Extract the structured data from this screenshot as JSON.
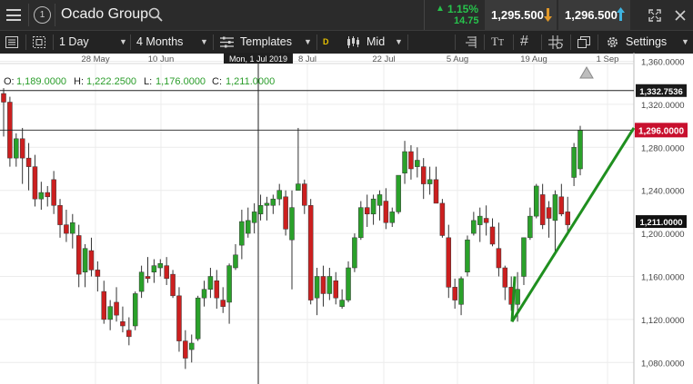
{
  "header": {
    "menu_icon": "hamburger-icon",
    "info_icon": "info-circle-icon",
    "instrument": "Ocado Group",
    "search_icon": "search-icon",
    "change_pct": "1.15%",
    "change_abs": "14.75",
    "sell_price": "1,295.500",
    "buy_price": "1,296.500",
    "sell_icon": "arrow-down-icon",
    "buy_icon": "arrow-up-icon",
    "fullscreen_icon": "fullscreen-icon",
    "close_icon": "close-icon",
    "colors": {
      "up": "#27c24c",
      "sell_arrow": "#e0982a",
      "buy_arrow": "#3fb3e0"
    }
  },
  "toolbar": {
    "interval": "1 Day",
    "range": "4 Months",
    "templates": "Templates",
    "d_badge": "D",
    "price_type": "Mid",
    "settings": "Settings",
    "icons": [
      "list-icon",
      "layout-icon",
      "templates-icon",
      "text-icon",
      "grid-icon",
      "crosshair-settings-icon",
      "window-icon",
      "gear-icon"
    ]
  },
  "crosshair_date": "Mon, 1 Jul 2019",
  "ohlc": {
    "o_label": "O:",
    "o": "1,189.0000",
    "h_label": "H:",
    "h": "1,222.2500",
    "l_label": "L:",
    "l": "1,176.0000",
    "c_label": "C:",
    "c": "1,211.0000"
  },
  "price_labels": {
    "crosshair": "1,332.7536",
    "current": "1,296.0000",
    "close": "1,211.0000"
  },
  "chart_data": {
    "type": "candlestick",
    "x_ticks": [
      "28 May",
      "10 Jun",
      "Mon, 1 Jul 2019",
      "8 Jul",
      "22 Jul",
      "5 Aug",
      "19 Aug",
      "1 Sep"
    ],
    "y_ticks": [
      "1,080.0000",
      "1,120.0000",
      "1,160.0000",
      "1,200.0000",
      "1,240.0000",
      "1,280.0000",
      "1,320.0000",
      "1,360.0000"
    ],
    "ylim": [
      1060,
      1368
    ],
    "grid": true,
    "crosshair_price": 1332.7536,
    "current_price": 1296,
    "trendline": [
      [
        1118,
        1298
      ],
      [
        1118,
        1118
      ]
    ],
    "candles": [
      [
        1330,
        1335,
        1290,
        1322
      ],
      [
        1322,
        1327,
        1262,
        1270
      ],
      [
        1270,
        1293,
        1262,
        1288
      ],
      [
        1288,
        1298,
        1246,
        1270
      ],
      [
        1270,
        1284,
        1240,
        1262
      ],
      [
        1262,
        1273,
        1225,
        1232
      ],
      [
        1232,
        1248,
        1222,
        1238
      ],
      [
        1238,
        1244,
        1225,
        1234
      ],
      [
        1250,
        1258,
        1218,
        1226
      ],
      [
        1226,
        1232,
        1196,
        1208
      ],
      [
        1208,
        1222,
        1192,
        1200
      ],
      [
        1200,
        1218,
        1186,
        1210
      ],
      [
        1198,
        1208,
        1150,
        1162
      ],
      [
        1164,
        1190,
        1150,
        1186
      ],
      [
        1184,
        1196,
        1160,
        1166
      ],
      [
        1166,
        1174,
        1146,
        1160
      ],
      [
        1146,
        1156,
        1116,
        1120
      ],
      [
        1120,
        1138,
        1110,
        1132
      ],
      [
        1136,
        1150,
        1118,
        1124
      ],
      [
        1118,
        1132,
        1108,
        1114
      ],
      [
        1110,
        1122,
        1096,
        1104
      ],
      [
        1114,
        1146,
        1110,
        1144
      ],
      [
        1146,
        1170,
        1140,
        1164
      ],
      [
        1160,
        1178,
        1154,
        1158
      ],
      [
        1164,
        1176,
        1154,
        1170
      ],
      [
        1168,
        1176,
        1160,
        1172
      ],
      [
        1170,
        1178,
        1152,
        1158
      ],
      [
        1162,
        1166,
        1140,
        1142
      ],
      [
        1142,
        1150,
        1090,
        1100
      ],
      [
        1100,
        1110,
        1074,
        1084
      ],
      [
        1092,
        1106,
        1080,
        1098
      ],
      [
        1102,
        1142,
        1100,
        1140
      ],
      [
        1140,
        1156,
        1132,
        1148
      ],
      [
        1148,
        1168,
        1140,
        1160
      ],
      [
        1156,
        1166,
        1130,
        1140
      ],
      [
        1138,
        1150,
        1126,
        1132
      ],
      [
        1136,
        1172,
        1116,
        1170
      ],
      [
        1168,
        1190,
        1166,
        1180
      ],
      [
        1189,
        1222,
        1176,
        1211
      ],
      [
        1200,
        1224,
        1196,
        1212
      ],
      [
        1210,
        1228,
        1200,
        1220
      ],
      [
        1218,
        1236,
        1212,
        1226
      ],
      [
        1226,
        1234,
        1212,
        1228
      ],
      [
        1226,
        1236,
        1218,
        1232
      ],
      [
        1232,
        1246,
        1226,
        1240
      ],
      [
        1234,
        1240,
        1198,
        1204
      ],
      [
        1194,
        1240,
        1148,
        1224
      ],
      [
        1240,
        1298,
        1240,
        1246
      ],
      [
        1246,
        1250,
        1218,
        1226
      ],
      [
        1226,
        1232,
        1134,
        1138
      ],
      [
        1140,
        1168,
        1124,
        1160
      ],
      [
        1160,
        1170,
        1132,
        1144
      ],
      [
        1144,
        1168,
        1138,
        1160
      ],
      [
        1156,
        1164,
        1134,
        1140
      ],
      [
        1132,
        1148,
        1130,
        1138
      ],
      [
        1138,
        1174,
        1136,
        1168
      ],
      [
        1168,
        1200,
        1164,
        1196
      ],
      [
        1196,
        1230,
        1194,
        1224
      ],
      [
        1224,
        1236,
        1206,
        1218
      ],
      [
        1218,
        1236,
        1208,
        1232
      ],
      [
        1226,
        1240,
        1212,
        1236
      ],
      [
        1230,
        1242,
        1204,
        1210
      ],
      [
        1210,
        1224,
        1206,
        1220
      ],
      [
        1220,
        1244,
        1218,
        1254
      ],
      [
        1256,
        1286,
        1246,
        1276
      ],
      [
        1276,
        1282,
        1250,
        1260
      ],
      [
        1262,
        1280,
        1252,
        1268
      ],
      [
        1262,
        1270,
        1232,
        1246
      ],
      [
        1246,
        1262,
        1236,
        1250
      ],
      [
        1250,
        1262,
        1228,
        1228
      ],
      [
        1228,
        1232,
        1196,
        1198
      ],
      [
        1196,
        1208,
        1140,
        1150
      ],
      [
        1150,
        1158,
        1130,
        1138
      ],
      [
        1134,
        1160,
        1124,
        1158
      ],
      [
        1164,
        1198,
        1160,
        1194
      ],
      [
        1200,
        1220,
        1198,
        1212
      ],
      [
        1208,
        1224,
        1192,
        1216
      ],
      [
        1214,
        1226,
        1198,
        1210
      ],
      [
        1206,
        1214,
        1188,
        1190
      ],
      [
        1186,
        1210,
        1160,
        1168
      ],
      [
        1168,
        1170,
        1138,
        1150
      ],
      [
        1150,
        1160,
        1128,
        1134
      ],
      [
        1134,
        1164,
        1118,
        1148
      ],
      [
        1160,
        1196,
        1152,
        1196
      ],
      [
        1196,
        1224,
        1194,
        1216
      ],
      [
        1216,
        1246,
        1214,
        1244
      ],
      [
        1236,
        1246,
        1204,
        1208
      ],
      [
        1224,
        1230,
        1196,
        1214
      ],
      [
        1212,
        1240,
        1180,
        1236
      ],
      [
        1234,
        1246,
        1216,
        1218
      ],
      [
        1220,
        1234,
        1200,
        1208
      ],
      [
        1252,
        1284,
        1244,
        1280
      ],
      [
        1260,
        1300,
        1254,
        1296
      ]
    ]
  }
}
